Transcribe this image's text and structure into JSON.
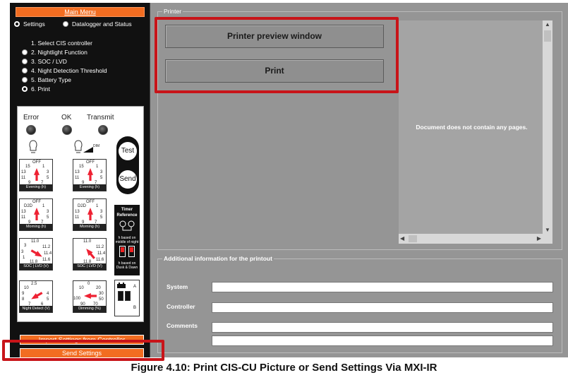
{
  "sidebar": {
    "main_menu": "Main Menu",
    "views": [
      {
        "label": "Settings",
        "selected": true
      },
      {
        "label": "Datalogger and Status",
        "selected": false
      }
    ],
    "steps": [
      {
        "label": "1. Select CIS controller",
        "radio": "none"
      },
      {
        "label": "2. Nightlight Function",
        "radio": "off"
      },
      {
        "label": "3. SOC / LVD",
        "radio": "off"
      },
      {
        "label": "4. Night Detection Threshold",
        "radio": "off"
      },
      {
        "label": "5. Battery Type",
        "radio": "off"
      },
      {
        "label": "6. Print",
        "radio": "on"
      }
    ],
    "import_button": "Import Settings from Controller",
    "send_button": "Send Settings"
  },
  "device": {
    "leds": [
      "Error",
      "OK",
      "Transmit"
    ],
    "dim_label": "DIM",
    "test_button": "Test",
    "send_button": "Send",
    "dials": {
      "evening_left": {
        "caption": "Evening (h)",
        "top": "OFF",
        "nums": [
          "15",
          "1",
          "13",
          "3",
          "11",
          "5",
          "9",
          "7"
        ]
      },
      "evening_right": {
        "caption": "Evening (h)",
        "top": "OFF",
        "nums": [
          "15",
          "1",
          "13",
          "3",
          "11",
          "5",
          "9",
          "7"
        ]
      },
      "morning_left": {
        "caption": "Morning (h)",
        "top": "OFF",
        "nums": [
          "D2D",
          "1",
          "13",
          "3",
          "11",
          "5",
          "9",
          "7"
        ]
      },
      "morning_right": {
        "caption": "Morning (h)",
        "top": "OFF",
        "nums": [
          "D2D",
          "1",
          "13",
          "3",
          "11",
          "5",
          "9",
          "7"
        ]
      },
      "soc_left": {
        "caption_a": "SOC",
        "caption_b": "LVD (V)",
        "nums": [
          "11.0",
          "3",
          "11.2",
          "3",
          "11.4",
          "1",
          "11.6",
          "11.8"
        ]
      },
      "soc_right": {
        "caption_a": "SOC",
        "caption_b": "LVD (V)",
        "nums": [
          "11.0",
          "11.2",
          "11.4",
          "11.6",
          "11.8"
        ]
      },
      "night_detect": {
        "caption": "Night Detect (V)",
        "nums": [
          "2.5",
          "10",
          "9",
          "4",
          "8",
          "5",
          "7",
          "6"
        ]
      },
      "dimming": {
        "caption": "Dimming (%)",
        "nums": [
          "0",
          "10",
          "20",
          "30",
          "100",
          "50",
          "90",
          "70"
        ]
      }
    },
    "timer_reference": {
      "title": "Timer Reference",
      "option_a": "h based on middle of night",
      "option_b": "h based on Dusk & Dawn",
      "switch_a": "A",
      "switch_b": "B"
    }
  },
  "printer": {
    "group_title": "Printer",
    "preview_button": "Printer preview window",
    "print_button": "Print",
    "preview_message": "Document does not contain any pages."
  },
  "info": {
    "group_title": "Additional information for the printout",
    "fields": [
      {
        "label": "System",
        "value": ""
      },
      {
        "label": "Controller",
        "value": ""
      },
      {
        "label": "Comments",
        "value": ""
      }
    ]
  },
  "caption": "Figure 4.10: Print CIS-CU Picture or Send Settings Via MXI-IR",
  "colors": {
    "accent": "#f26d21",
    "highlight": "#c81419",
    "panel": "#959595"
  }
}
